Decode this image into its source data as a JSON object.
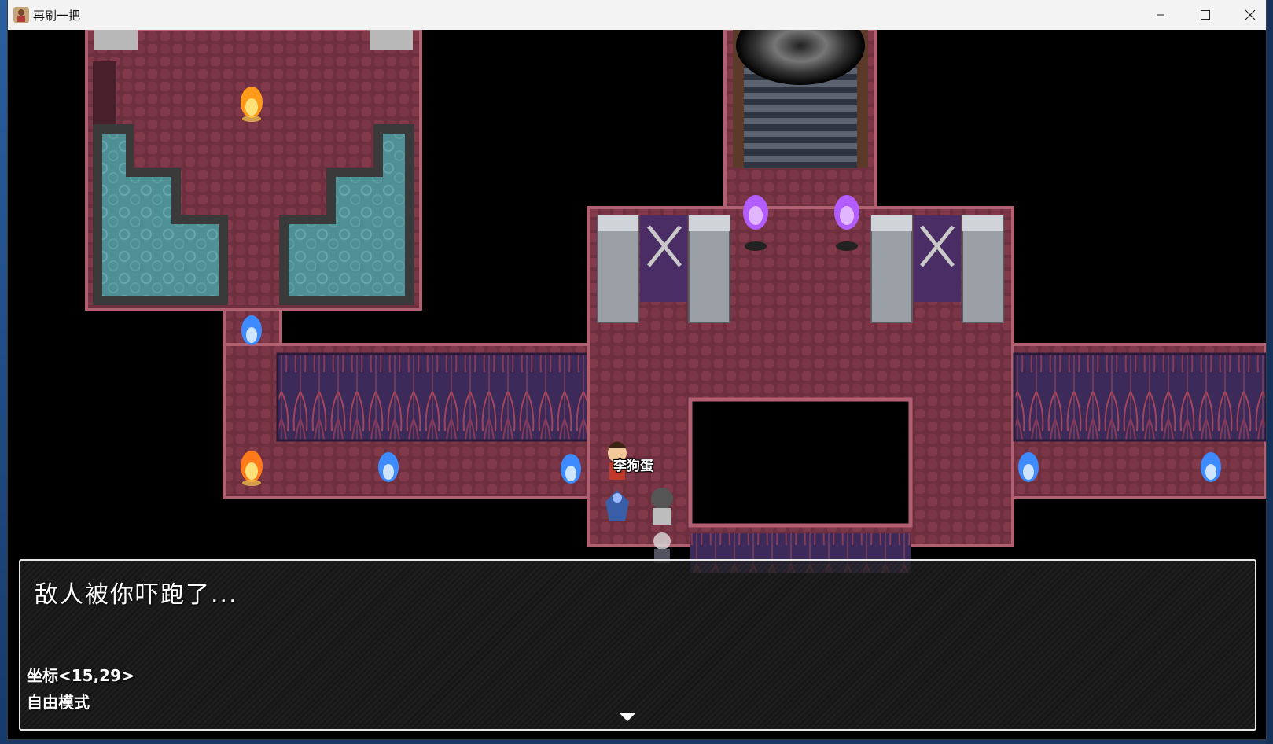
{
  "window": {
    "title": "再刷一把",
    "icon": "game-app-icon",
    "controls": [
      "minimize-icon",
      "maximize-icon",
      "close-icon"
    ]
  },
  "scene": {
    "character_name": "李狗蛋",
    "flame_colors": {
      "orange": "#ff9a1a",
      "blue": "#3d8bff",
      "purple": "#b35cff"
    },
    "floor_color": "#6e2f3e",
    "water_color": "#4f8f96"
  },
  "message": {
    "text": "敌人被你吓跑了...",
    "coordinate": "坐标<15,29>",
    "mode": "自由模式",
    "continue_icon": "down-triangle-icon"
  }
}
